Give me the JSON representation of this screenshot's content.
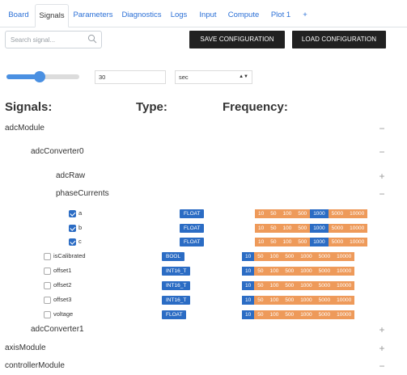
{
  "tabs": [
    {
      "label": "Board",
      "active": false
    },
    {
      "label": "Signals",
      "active": true
    },
    {
      "label": "Parameters",
      "active": false
    },
    {
      "label": "Diagnostics",
      "active": false
    },
    {
      "label": "Logs",
      "active": false
    },
    {
      "label": "Input",
      "active": false
    },
    {
      "label": "Compute",
      "active": false
    },
    {
      "label": "Plot 1",
      "active": false
    },
    {
      "label": "+",
      "active": false
    }
  ],
  "toolbar": {
    "search_placeholder": "Search signal...",
    "save_label": "SAVE CONFIGURATION",
    "load_label": "LOAD CONFIGURATION",
    "interval_value": "30",
    "unit_value": "sec",
    "slider_level": 0.45
  },
  "headers": {
    "signals": "Signals:",
    "type": "Type:",
    "frequency": "Frequency:"
  },
  "tree": {
    "adcModule": "adcModule",
    "adcConverter0": "adcConverter0",
    "adcRaw": "adcRaw",
    "phaseCurrents": "phaseCurrents",
    "adcConverter1": "adcConverter1",
    "axisModule": "axisModule",
    "controllerModule": "controllerModule",
    "collapse_symbol": "−",
    "expand_symbol": "+"
  },
  "frequency_options": [
    "10",
    "50",
    "100",
    "500",
    "1000",
    "5000",
    "10000"
  ],
  "signals": [
    {
      "name": "a",
      "type": "FLOAT",
      "checked": true,
      "selected": "1000"
    },
    {
      "name": "b",
      "type": "FLOAT",
      "checked": true,
      "selected": "1000"
    },
    {
      "name": "c",
      "type": "FLOAT",
      "checked": true,
      "selected": "1000"
    },
    {
      "name": "isCalibrated",
      "type": "BOOL",
      "checked": false,
      "selected": "10"
    },
    {
      "name": "offset1",
      "type": "INT16_T",
      "checked": false,
      "selected": "10"
    },
    {
      "name": "offset2",
      "type": "INT16_T",
      "checked": false,
      "selected": "10"
    },
    {
      "name": "offset3",
      "type": "INT16_T",
      "checked": false,
      "selected": "10"
    },
    {
      "name": "voltage",
      "type": "FLOAT",
      "checked": false,
      "selected": "10"
    }
  ]
}
